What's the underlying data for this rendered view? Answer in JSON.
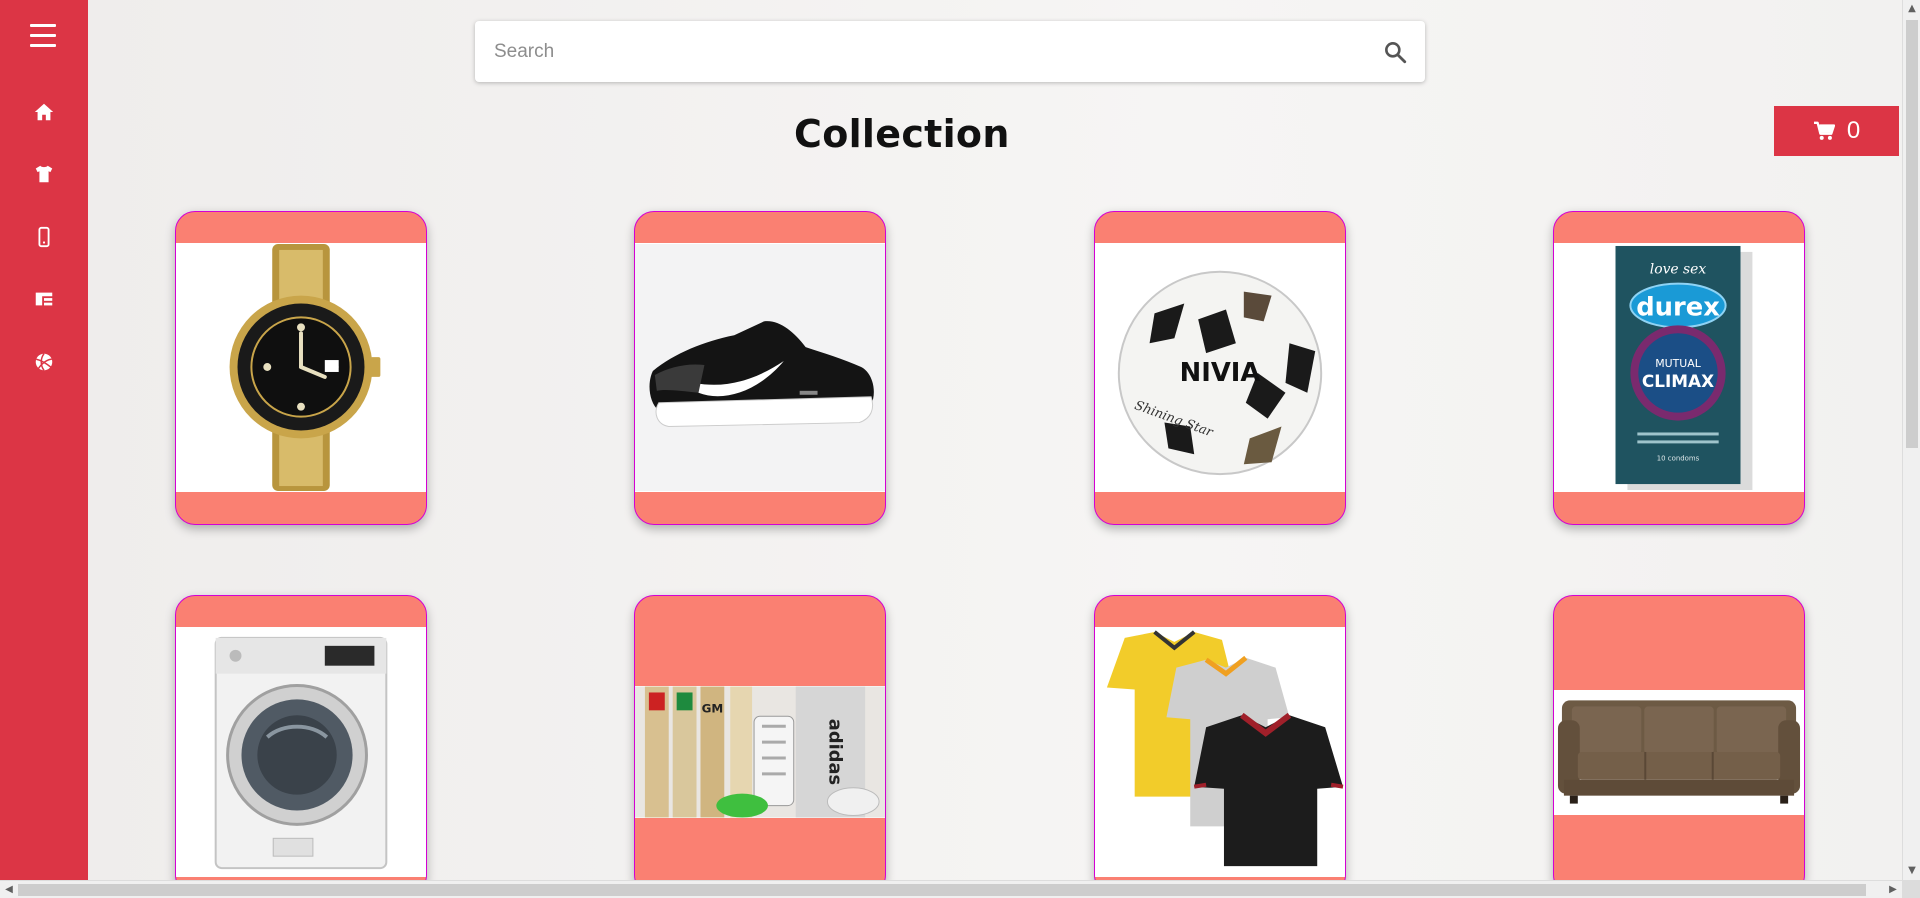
{
  "search": {
    "placeholder": "Search",
    "value": ""
  },
  "page": {
    "title": "Collection"
  },
  "cart": {
    "count": "0"
  },
  "sidebar": {
    "items": [
      {
        "icon": "menu-icon"
      },
      {
        "icon": "home-icon"
      },
      {
        "icon": "tshirt-icon"
      },
      {
        "icon": "mobile-icon"
      },
      {
        "icon": "appliance-icon"
      },
      {
        "icon": "sports-ball-icon"
      }
    ]
  },
  "products": [
    {
      "name": "watch",
      "image": "gold-watch"
    },
    {
      "name": "shoe",
      "image": "black-sneaker"
    },
    {
      "name": "football",
      "image": "nivia-football"
    },
    {
      "name": "condom",
      "image": "durex-pack"
    },
    {
      "name": "washing machine",
      "image": "washing-machine"
    },
    {
      "name": "cricket kit",
      "image": "cricket-kit"
    },
    {
      "name": "polo shirts",
      "image": "polo-shirts"
    },
    {
      "name": "sofa",
      "image": "brown-sofa"
    }
  ],
  "brand_texts": {
    "football": "NIVIA",
    "football_sub": "Shining Star",
    "condom_top": "love sex",
    "condom_brand": "durex",
    "condom_line1": "MUTUAL",
    "condom_line2": "CLIMAX",
    "condom_count": "10 condoms",
    "cricket_brand": "adidas",
    "cricket_gm": "GM"
  },
  "colors": {
    "accent": "#dc3545",
    "card": "#fa8072",
    "card_border": "#d400d4",
    "page_bg": "#f2f0ee"
  }
}
